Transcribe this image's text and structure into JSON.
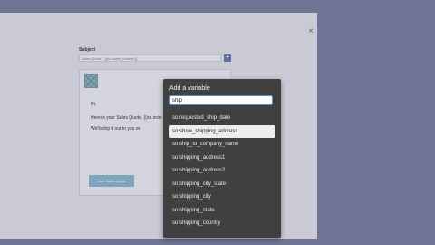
{
  "modal": {
    "close_glyph": "×",
    "subject_label": "Subject",
    "subject_value": "Sales Quote - {{so.order_number}}",
    "add_glyph": "+",
    "email": {
      "greeting": "Hi,",
      "body_line": "Here is your Sales Quote, {{so.orde",
      "ship_line": "We'll ship it out to you on",
      "view_button": "View Sales Quote"
    }
  },
  "popup": {
    "title": "Add a variable",
    "search_value": "ship",
    "selected_index": 1,
    "items": [
      "so.requested_ship_date",
      "so.show_shipping_address",
      "so.ship_to_company_name",
      "so.shipping_address1",
      "so.shipping_address2",
      "so.shipping_city_state",
      "so.shipping_city",
      "so.shipping_state",
      "so.shipping_country"
    ]
  },
  "colors": {
    "backdrop": "#6f7494",
    "popup_bg": "#404040",
    "accent": "#4a8fd4",
    "button_blue": "#7da5bb"
  }
}
